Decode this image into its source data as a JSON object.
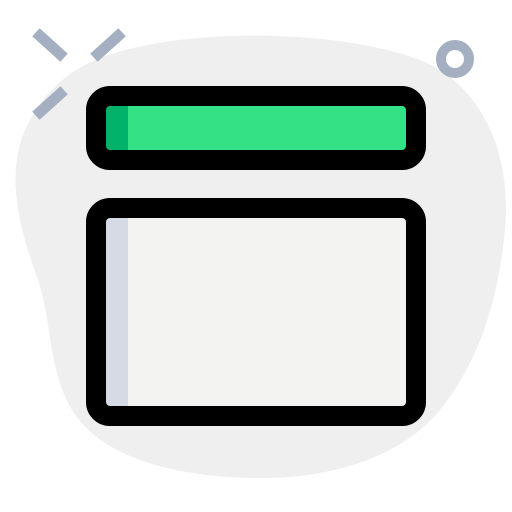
{
  "icon": {
    "name": "browser-window-layout-icon",
    "style": "filled-outline"
  },
  "colors": {
    "background": "#ffffff",
    "blob": "#efefef",
    "header_fill": "#34e185",
    "header_accent": "#00b26a",
    "content_fill": "#f3f3f1",
    "content_accent": "#d5dae4",
    "outline": "#000000",
    "decoration": "#a4afc1"
  },
  "decorations": [
    "sparkle-lines",
    "ring"
  ]
}
